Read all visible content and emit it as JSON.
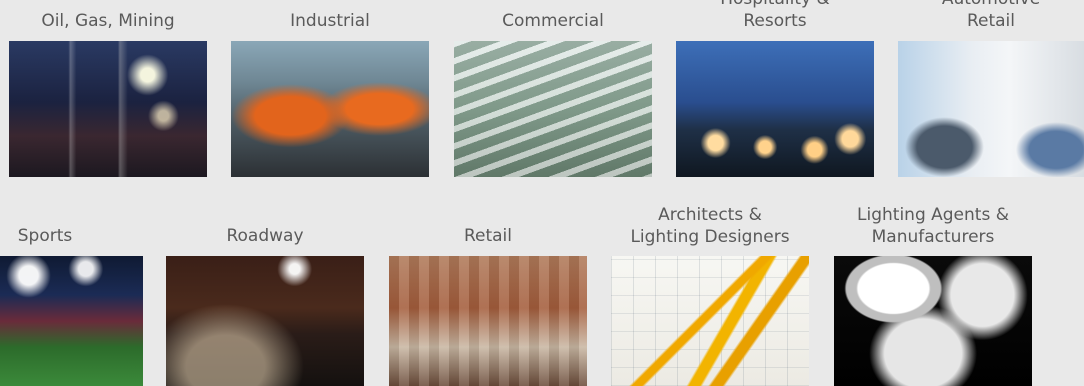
{
  "row1": [
    {
      "id": "oil",
      "label": "Oil, Gas, Mining"
    },
    {
      "id": "ind",
      "label": "Industrial"
    },
    {
      "id": "com",
      "label": "Commercial"
    },
    {
      "id": "hos",
      "label": "Hospitality &\nResorts"
    },
    {
      "id": "auto",
      "label": "Automotive\nRetail"
    }
  ],
  "row2": [
    {
      "id": "sports",
      "label": "Sports"
    },
    {
      "id": "road",
      "label": "Roadway"
    },
    {
      "id": "retail",
      "label": "Retail"
    },
    {
      "id": "arch",
      "label": "Architects &\nLighting Designers"
    },
    {
      "id": "agents",
      "label": "Lighting Agents &\nManufacturers"
    }
  ]
}
